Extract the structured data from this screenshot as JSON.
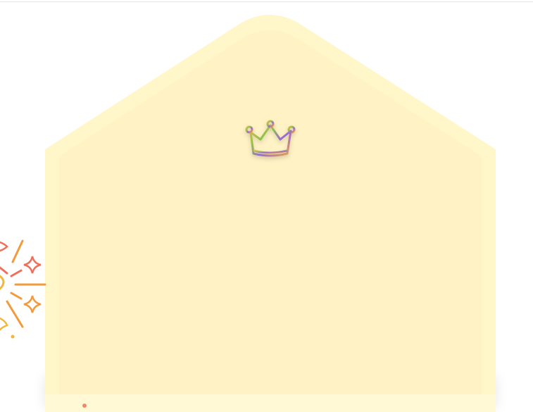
{
  "colors": {
    "envelope_outer": "#fff7c9",
    "envelope_inner": "#fff2c4",
    "footer": "#fff9d6",
    "footer_dot": "#f08a6c",
    "firework_orange": "#f39a3c",
    "firework_coral": "#f06f5a",
    "crown_gradient": [
      "#e9b84c",
      "#8bc34a",
      "#9c6ad6",
      "#f2a33a"
    ]
  },
  "icons": {
    "crown": "crown-icon",
    "firework": "firework-sparkle-icon",
    "dot": "indicator-dot"
  }
}
